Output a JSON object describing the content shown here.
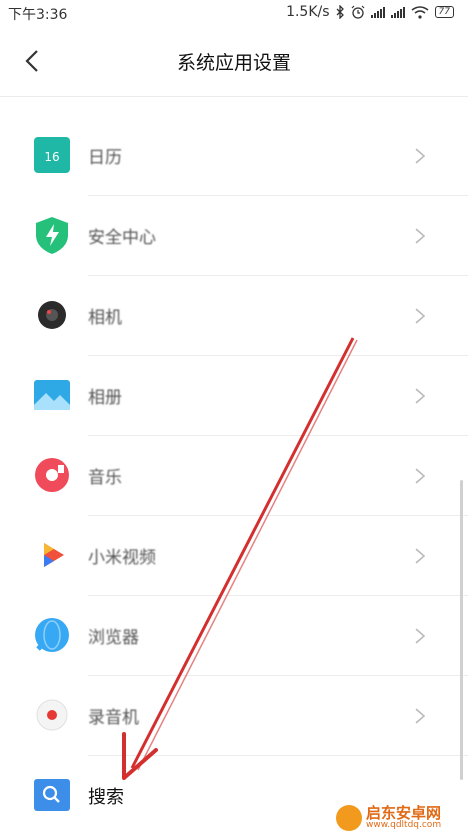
{
  "status_bar": {
    "time": "下午3:36",
    "network_speed": "1.5K/s",
    "battery": "77"
  },
  "header": {
    "title": "系统应用设置"
  },
  "list": {
    "items": [
      {
        "label": "日历",
        "icon": "calendar-icon",
        "color": "#1fb8a6"
      },
      {
        "label": "安全中心",
        "icon": "security-shield-icon",
        "color": "#25c17a"
      },
      {
        "label": "相机",
        "icon": "camera-icon",
        "color": "#333333"
      },
      {
        "label": "相册",
        "icon": "gallery-icon",
        "color": "#2fa8e6"
      },
      {
        "label": "音乐",
        "icon": "music-icon",
        "color": "#ef4b5a"
      },
      {
        "label": "小米视频",
        "icon": "video-icon",
        "color": "#f0503c"
      },
      {
        "label": "浏览器",
        "icon": "browser-icon",
        "color": "#37a8f3"
      },
      {
        "label": "录音机",
        "icon": "recorder-icon",
        "color": "#e53935"
      },
      {
        "label": "搜索",
        "icon": "search-icon",
        "color": "#3c8ee8"
      }
    ]
  },
  "watermark": {
    "name": "启东安卓网",
    "url": "www.qdltdq.com"
  },
  "accent": {
    "annotation_arrow": "#d32f2f"
  }
}
